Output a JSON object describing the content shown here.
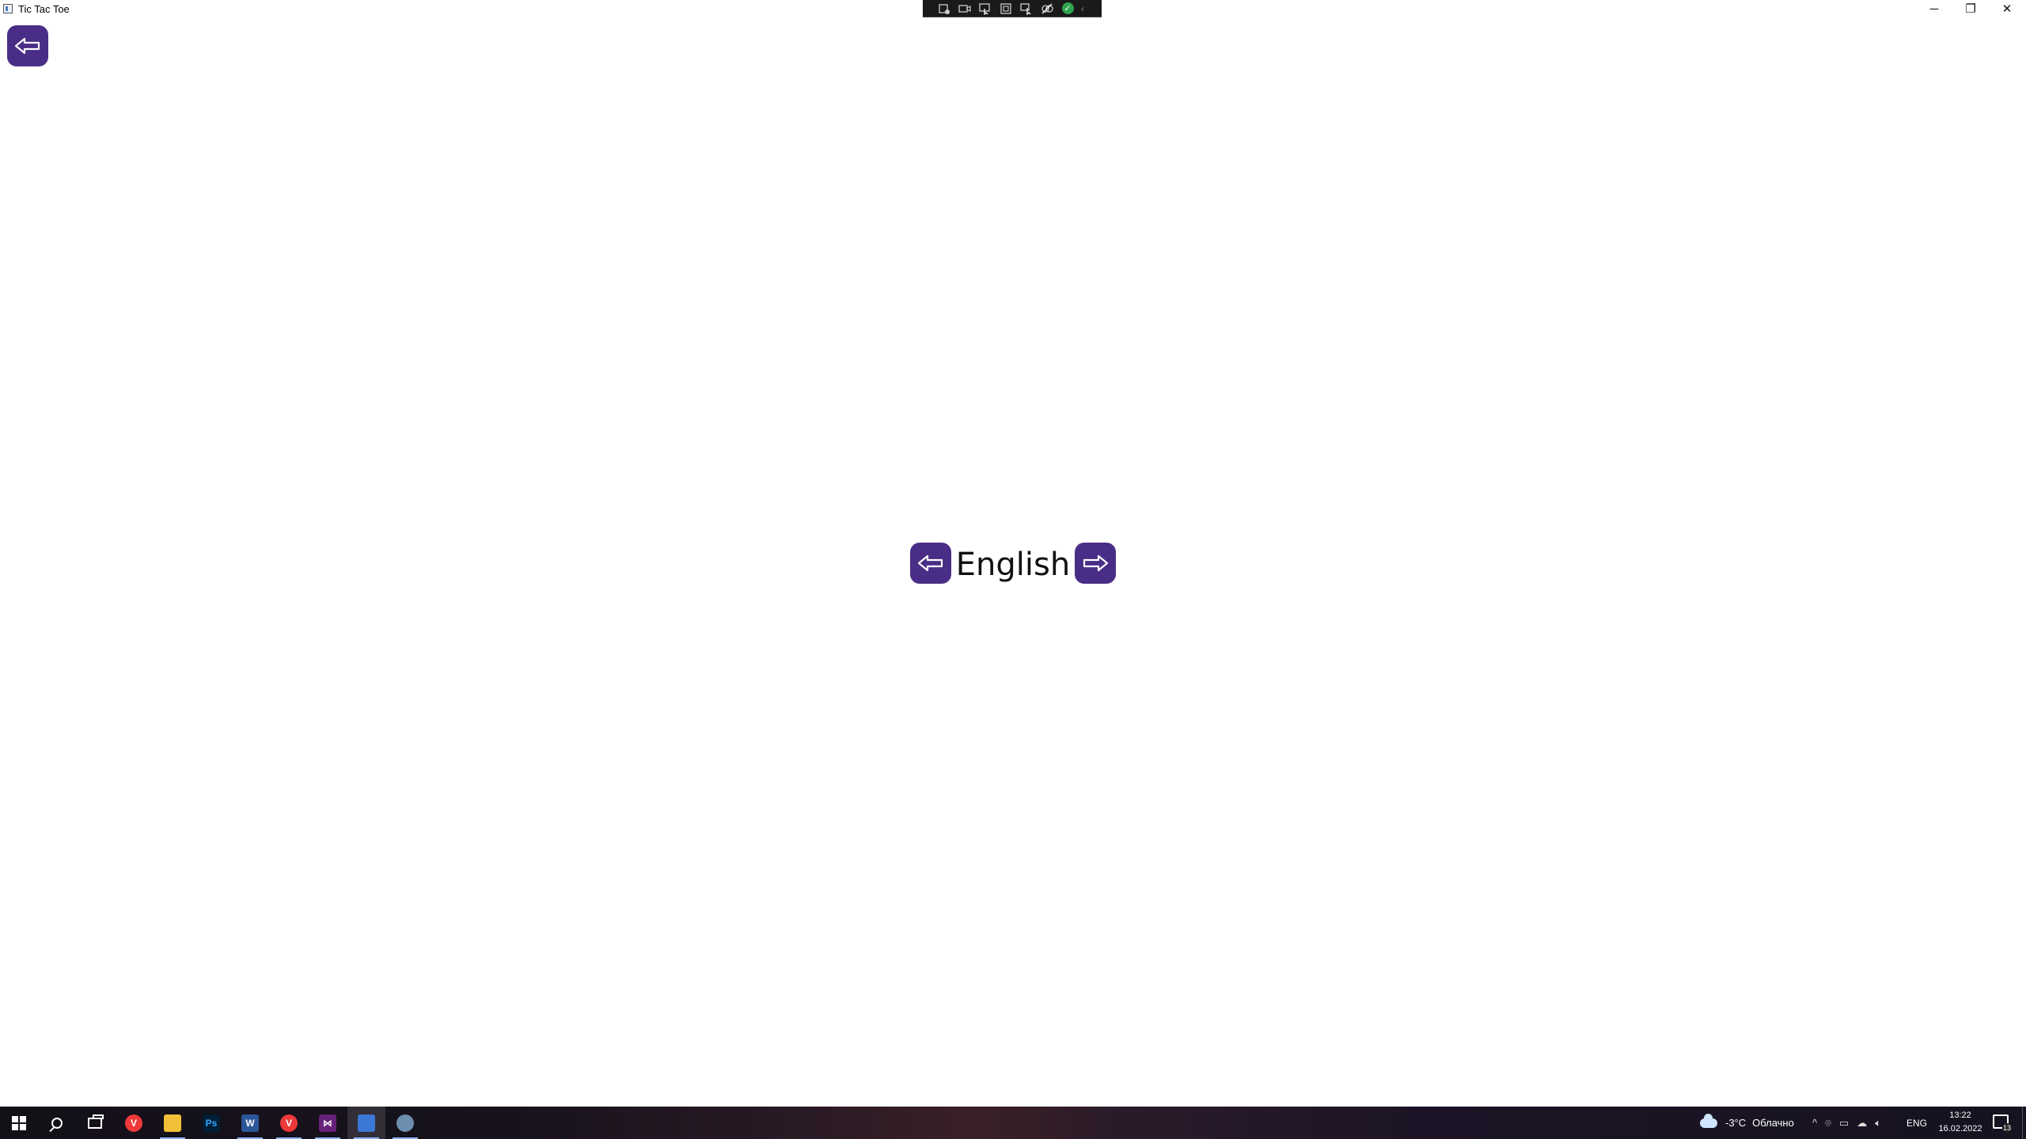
{
  "window": {
    "title": "Tic Tac Toe",
    "controls": {
      "minimize": "─",
      "maximize": "❐",
      "close": "✕"
    }
  },
  "recording_toolbar": {
    "buttons": [
      "capture-icon",
      "video-icon",
      "pointer-icon",
      "region-icon",
      "cursor-icon",
      "audio-off-icon"
    ],
    "status": "✓",
    "collapse": "‹"
  },
  "main": {
    "back_button_icon": "arrow-left-icon",
    "prev_language_icon": "arrow-left-icon",
    "next_language_icon": "arrow-right-icon",
    "language": "English",
    "accent_color": "#4a2d86"
  },
  "taskbar": {
    "apps": [
      {
        "name": "Start",
        "icon": "windows-logo-icon"
      },
      {
        "name": "Search",
        "icon": "search-icon"
      },
      {
        "name": "Task View",
        "icon": "task-view-icon"
      },
      {
        "name": "Vivaldi",
        "icon": "vivaldi-icon",
        "label": "V"
      },
      {
        "name": "File Explorer",
        "icon": "folder-icon"
      },
      {
        "name": "Photoshop",
        "icon": "photoshop-icon",
        "label": "Ps"
      },
      {
        "name": "Word",
        "icon": "word-icon",
        "label": "W"
      },
      {
        "name": "Vivaldi",
        "icon": "vivaldi-icon",
        "label": "V"
      },
      {
        "name": "Visual Studio",
        "icon": "visual-studio-icon",
        "label": "⋈"
      },
      {
        "name": "Tic Tac Toe",
        "icon": "tic-tac-toe-app-icon"
      },
      {
        "name": "Installer",
        "icon": "wizard-icon"
      }
    ],
    "weather": {
      "temp": "-3°C",
      "condition": "Облачно"
    },
    "tray": {
      "chevron": "^",
      "language": "ENG"
    },
    "clock": {
      "time": "13:22",
      "date": "16.02.2022"
    },
    "notifications": "13"
  }
}
